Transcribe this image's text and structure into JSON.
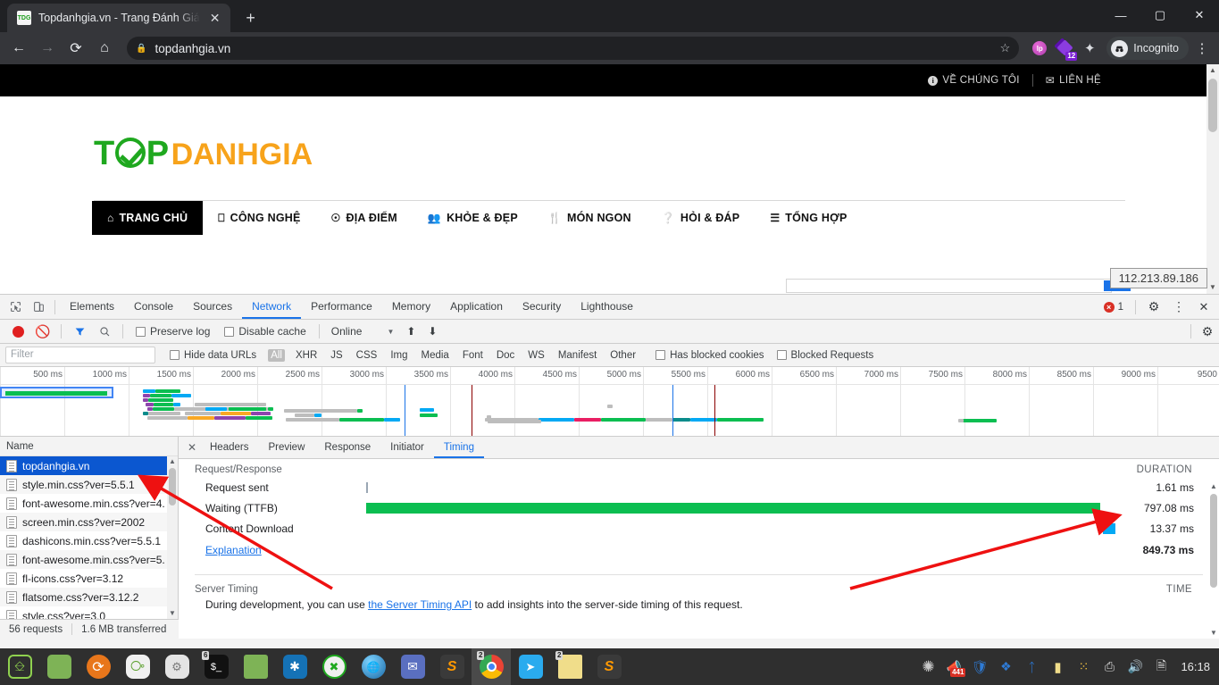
{
  "browser": {
    "tab": {
      "title": "Topdanhgia.vn - Trang Đánh Giá",
      "favicon_label": "TDG",
      "close_label": "✕"
    },
    "new_tab_label": "+",
    "window_controls": {
      "minimize": "—",
      "maximize": "▢",
      "close": "✕"
    },
    "nav": {
      "back": "←",
      "forward": "→",
      "reload": "⟳",
      "home": "⌂"
    },
    "omnibox": {
      "lock": "🔒",
      "url": "topdanhgia.vn",
      "star": "☆"
    },
    "extensions": [
      {
        "name": "lp-extension",
        "label": "lp"
      },
      {
        "name": "purple-extension",
        "badge": "12"
      },
      {
        "name": "puzzle-extension",
        "glyph": "🧩"
      }
    ],
    "incognito_label": "Incognito",
    "menu_label": "⋮"
  },
  "page": {
    "topbar": [
      {
        "icon": "info-icon",
        "label": "VỀ CHÚNG TÔI"
      },
      {
        "icon": "mail-icon",
        "label": "LIÊN HỆ"
      }
    ],
    "logo": {
      "part1": "T",
      "part2": "P",
      "part3": "DANHGIA"
    },
    "nav": [
      {
        "icon": "home-icon",
        "glyph": "⌂",
        "label": "TRANG CHỦ",
        "active": true
      },
      {
        "icon": "monitor-icon",
        "glyph": "🖵",
        "label": "CÔNG NGHỆ",
        "active": false
      },
      {
        "icon": "pin-icon",
        "glyph": "📍",
        "label": "ĐỊA ĐIỂM",
        "active": false
      },
      {
        "icon": "people-icon",
        "glyph": "👪",
        "label": "KHỎE & ĐẸP",
        "active": false
      },
      {
        "icon": "cutlery-icon",
        "glyph": "🍴",
        "label": "MÓN NGON",
        "active": false
      },
      {
        "icon": "question-icon",
        "glyph": "?",
        "label": "HỎI & ĐÁP",
        "active": false
      },
      {
        "icon": "layers-icon",
        "glyph": "≡",
        "label": "TỔNG HỢP",
        "active": false
      }
    ],
    "ip_tooltip": "112.213.89.186"
  },
  "devtools": {
    "panel_tabs": [
      {
        "label": "Elements",
        "active": false
      },
      {
        "label": "Console",
        "active": false
      },
      {
        "label": "Sources",
        "active": false
      },
      {
        "label": "Network",
        "active": true
      },
      {
        "label": "Performance",
        "active": false
      },
      {
        "label": "Memory",
        "active": false
      },
      {
        "label": "Application",
        "active": false
      },
      {
        "label": "Security",
        "active": false
      },
      {
        "label": "Lighthouse",
        "active": false
      }
    ],
    "error_count": "1",
    "toolbar": {
      "record_title": "record",
      "clear_title": "clear",
      "filter_title": "filter",
      "search_title": "search",
      "preserve_log": "Preserve log",
      "disable_cache": "Disable cache",
      "throttle_value": "Online",
      "caret": "▼",
      "import_glyph": "⬆",
      "export_glyph": "⬇",
      "settings_glyph": "⚙"
    },
    "filterbar": {
      "placeholder": "Filter",
      "hide_data_urls": "Hide data URLs",
      "types": [
        "All",
        "XHR",
        "JS",
        "CSS",
        "Img",
        "Media",
        "Font",
        "Doc",
        "WS",
        "Manifest",
        "Other"
      ],
      "active_type": "All",
      "has_blocked_cookies": "Has blocked cookies",
      "blocked_requests": "Blocked Requests"
    },
    "overview_ticks": [
      "500 ms",
      "1000 ms",
      "1500 ms",
      "2000 ms",
      "2500 ms",
      "3000 ms",
      "3500 ms",
      "4000 ms",
      "4500 ms",
      "5000 ms",
      "5500 ms",
      "6000 ms",
      "6500 ms",
      "7000 ms",
      "7500 ms",
      "8000 ms",
      "8500 ms",
      "9000 ms",
      "9500"
    ],
    "requests": {
      "column_header": "Name",
      "rows": [
        {
          "name": "topdanhgia.vn",
          "selected": true
        },
        {
          "name": "style.min.css?ver=5.5.1",
          "selected": false
        },
        {
          "name": "font-awesome.min.css?ver=4.",
          "selected": false
        },
        {
          "name": "screen.min.css?ver=2002",
          "selected": false
        },
        {
          "name": "dashicons.min.css?ver=5.5.1",
          "selected": false
        },
        {
          "name": "font-awesome.min.css?ver=5.",
          "selected": false
        },
        {
          "name": "fl-icons.css?ver=3.12",
          "selected": false
        },
        {
          "name": "flatsome.css?ver=3.12.2",
          "selected": false
        },
        {
          "name": "style.css?ver=3.0",
          "selected": false
        }
      ],
      "footer": {
        "requests": "56 requests",
        "transferred": "1.6 MB transferred"
      }
    },
    "details": {
      "close_glyph": "✕",
      "tabs": [
        {
          "label": "Headers",
          "active": false
        },
        {
          "label": "Preview",
          "active": false
        },
        {
          "label": "Response",
          "active": false
        },
        {
          "label": "Initiator",
          "active": false
        },
        {
          "label": "Timing",
          "active": true
        }
      ],
      "timing": {
        "section_title": "Request/Response",
        "duration_header": "DURATION",
        "rows": [
          {
            "label": "Request sent",
            "duration": "1.61 ms",
            "color": "#9aa7b4",
            "start_pct": 0.0,
            "width_pct": 0.25
          },
          {
            "label": "Waiting (TTFB)",
            "duration": "797.08 ms",
            "color": "#0bbe51",
            "start_pct": 0.0,
            "width_pct": 98.5
          },
          {
            "label": "Content Download",
            "duration": "13.37 ms",
            "color": "#03a9f4",
            "start_pct": 98.8,
            "width_pct": 1.7
          }
        ],
        "explanation_link": "Explanation",
        "total": "849.73 ms"
      },
      "server_timing": {
        "title": "Server Timing",
        "time_header": "TIME",
        "text_before": "During development, you can use ",
        "link": "the Server Timing API",
        "text_after": " to add insights into the server-side timing of this request."
      }
    }
  },
  "taskbar": {
    "items": [
      {
        "name": "mint-menu",
        "glyph": "ⓜ",
        "bg": "#2f2f2f",
        "color": "#8fd14f",
        "badge": ""
      },
      {
        "name": "file-manager-green",
        "glyph": "",
        "bg": "#7eb356",
        "color": "#fff",
        "badge": ""
      },
      {
        "name": "firefox",
        "glyph": "",
        "bg": "#e8761b",
        "color": "#fff",
        "badge": ""
      },
      {
        "name": "app-grid",
        "glyph": "⠿",
        "bg": "#f0f0f0",
        "color": "#5aa02c",
        "badge": ""
      },
      {
        "name": "toggles",
        "glyph": "⚏",
        "bg": "#e4e4e4",
        "color": "#7a7a7a",
        "badge": ""
      },
      {
        "name": "terminal",
        "glyph": "▭",
        "bg": "#111",
        "color": "#fff",
        "badge": "6"
      },
      {
        "name": "folder",
        "glyph": "",
        "bg": "#7eb356",
        "color": "#fff",
        "badge": ""
      },
      {
        "name": "vscode",
        "glyph": "✖",
        "bg": "#1572b6",
        "color": "#fff",
        "badge": ""
      },
      {
        "name": "remote-desktop",
        "glyph": "✕",
        "bg": "#f0f0f0",
        "color": "#1fa81f",
        "badge": ""
      },
      {
        "name": "network-globe",
        "glyph": "🌐",
        "bg": "#2f2f2f",
        "color": "#3fa9f5",
        "badge": ""
      },
      {
        "name": "mail-client",
        "glyph": "✉",
        "bg": "#5a6fc0",
        "color": "#fff",
        "badge": ""
      },
      {
        "name": "sublime-text",
        "glyph": "S",
        "bg": "#3a3a3a",
        "color": "#ff9800",
        "badge": ""
      },
      {
        "name": "chrome",
        "glyph": "",
        "bg": "#4a4a4a",
        "color": "#fff",
        "badge": "2"
      },
      {
        "name": "telegram",
        "glyph": "➤",
        "bg": "#2aabee",
        "color": "#fff",
        "badge": ""
      },
      {
        "name": "notes",
        "glyph": "",
        "bg": "#f0dd8a",
        "color": "#7a6a20",
        "badge": "2"
      },
      {
        "name": "sublime-text-2",
        "glyph": "S",
        "bg": "#3a3a3a",
        "color": "#ff9800",
        "badge": ""
      }
    ],
    "tray": [
      {
        "name": "shutter-icon",
        "glyph": "✻",
        "badge": ""
      },
      {
        "name": "megaphone-icon",
        "glyph": "📣",
        "badge": "441"
      },
      {
        "name": "shield-icon",
        "glyph": "🛡",
        "badge": ""
      },
      {
        "name": "dropbox-icon",
        "glyph": "❖",
        "badge": ""
      },
      {
        "name": "bluetooth-icon",
        "glyph": "ᛒ",
        "badge": ""
      },
      {
        "name": "notes-tray-icon",
        "glyph": "▰",
        "badge": ""
      },
      {
        "name": "colors-icon",
        "glyph": "⁙",
        "badge": ""
      },
      {
        "name": "printer-icon",
        "glyph": "⎙",
        "badge": ""
      },
      {
        "name": "volume-icon",
        "glyph": "🔊",
        "badge": ""
      },
      {
        "name": "battery-icon",
        "glyph": "🗎",
        "badge": ""
      }
    ],
    "clock": "16:18"
  }
}
